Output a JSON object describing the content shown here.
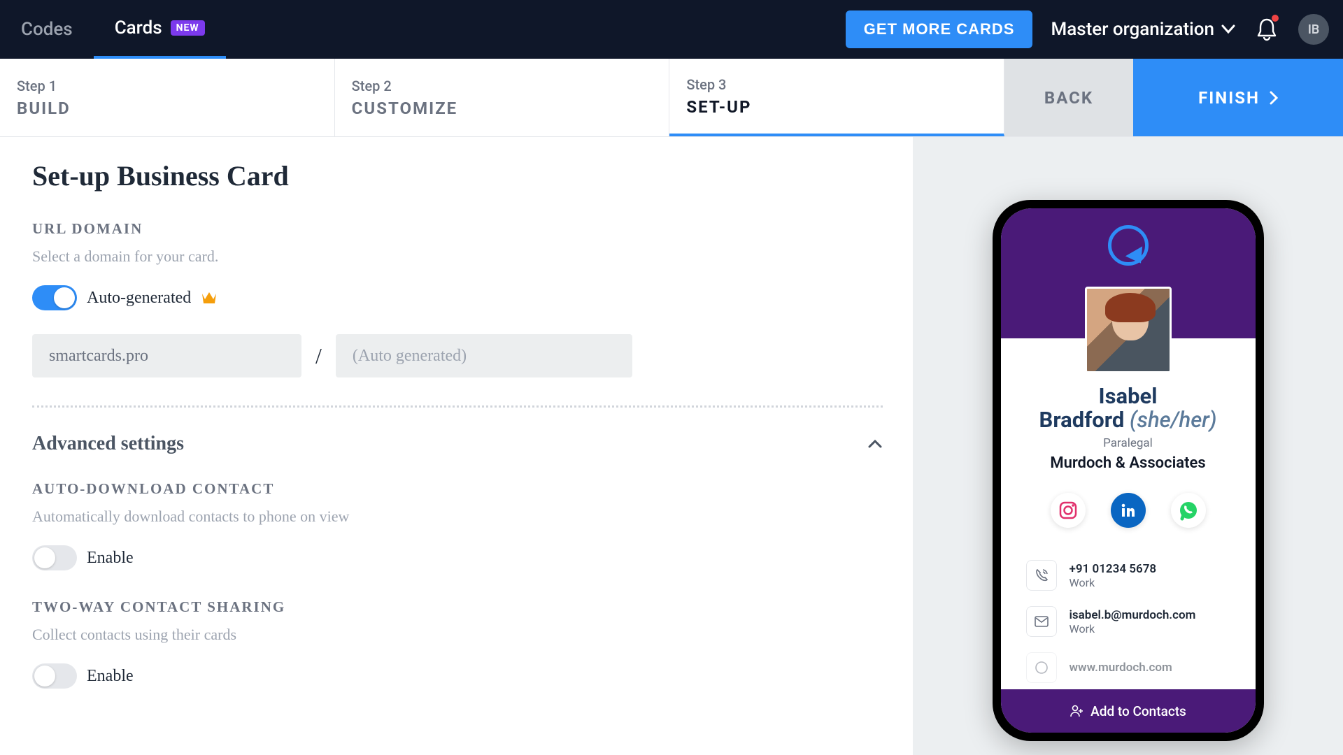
{
  "nav": {
    "tab_codes": "Codes",
    "tab_cards": "Cards",
    "badge_new": "NEW",
    "get_more": "GET MORE CARDS",
    "org_name": "Master organization",
    "avatar_initials": "IB"
  },
  "steps": {
    "s1_num": "Step 1",
    "s1_name": "BUILD",
    "s2_num": "Step 2",
    "s2_name": "CUSTOMIZE",
    "s3_num": "Step 3",
    "s3_name": "SET-UP",
    "back": "BACK",
    "finish": "FINISH"
  },
  "form": {
    "title": "Set-up Business Card",
    "url_domain_label": "URL DOMAIN",
    "url_domain_desc": "Select a domain for your card.",
    "autogen_label": "Auto-generated",
    "domain_value": "smartcards.pro",
    "slug_placeholder": "(Auto generated)",
    "slash": "/",
    "adv_title": "Advanced settings",
    "auto_dl_label": "AUTO-DOWNLOAD CONTACT",
    "auto_dl_desc": "Automatically download contacts to phone on view",
    "enable_label": "Enable",
    "two_way_label": "TWO-WAY CONTACT SHARING",
    "two_way_desc": "Collect contacts using their cards"
  },
  "preview": {
    "first_name": "Isabel",
    "last_name": "Bradford",
    "pronoun": "(she/her)",
    "role": "Paralegal",
    "company": "Murdoch & Associates",
    "phone": "+91 01234 5678",
    "phone_label": "Work",
    "email": "isabel.b@murdoch.com",
    "email_label": "Work",
    "website": "www.murdoch.com",
    "add_contacts": "Add to Contacts"
  }
}
